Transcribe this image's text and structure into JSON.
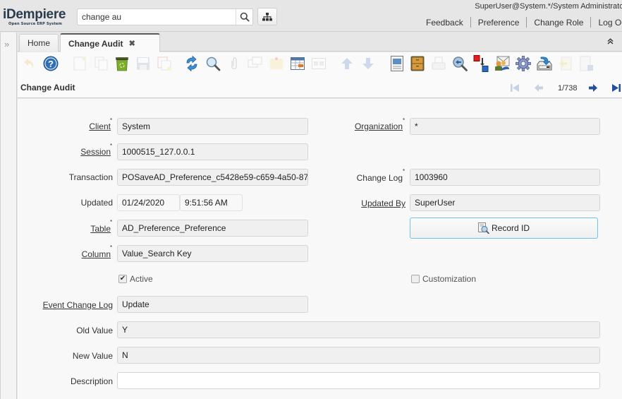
{
  "app": {
    "logo_text": "iDempiere",
    "logo_tagline": "Open Source ERP System"
  },
  "header": {
    "search": {
      "value": "change au",
      "placeholder": ""
    },
    "search_icon": "search-icon",
    "menu_tree_icon": "sitemap-icon",
    "user_info": "SuperUser@System.*/System Administrator",
    "links": [
      "Feedback",
      "Preference",
      "Change Role",
      "Log Out"
    ]
  },
  "tabs": [
    {
      "label": "Home",
      "active": false
    },
    {
      "label": "Change Audit",
      "active": true,
      "closable": true
    }
  ],
  "tab_close_glyph": "✖",
  "west_expand_glyph": "»",
  "collapse_glyph": "⌃",
  "toolbar": {
    "buttons": [
      {
        "name": "undo",
        "icon": "undo-icon",
        "enabled": false
      },
      {
        "name": "help",
        "icon": "help-icon",
        "enabled": true
      },
      {
        "name": "new",
        "icon": "new-record-icon",
        "enabled": false
      },
      {
        "name": "copy",
        "icon": "copy-record-icon",
        "enabled": false
      },
      {
        "name": "delete",
        "icon": "delete-icon",
        "enabled": true
      },
      {
        "name": "save",
        "icon": "save-icon",
        "enabled": false
      },
      {
        "name": "save-create",
        "icon": "save-create-icon",
        "enabled": false
      },
      {
        "name": "refresh",
        "icon": "refresh-icon",
        "enabled": true
      },
      {
        "name": "find",
        "icon": "find-icon",
        "enabled": true
      },
      {
        "name": "attachment",
        "icon": "attachment-icon",
        "enabled": false
      },
      {
        "name": "chat",
        "icon": "chat-icon",
        "enabled": false
      },
      {
        "name": "postit",
        "icon": "postit-icon",
        "enabled": false
      },
      {
        "name": "grid-toggle",
        "icon": "grid-toggle-icon",
        "enabled": true
      },
      {
        "name": "multi",
        "icon": "multi-view-icon",
        "enabled": false
      },
      {
        "name": "parent",
        "icon": "arrow-up-icon",
        "enabled": false
      },
      {
        "name": "detail",
        "icon": "arrow-down-icon",
        "enabled": false
      },
      {
        "name": "report",
        "icon": "report-icon",
        "enabled": true
      },
      {
        "name": "archive",
        "icon": "archive-icon",
        "enabled": true
      },
      {
        "name": "print",
        "icon": "print-icon",
        "enabled": false
      },
      {
        "name": "zoom-across",
        "icon": "zoom-across-icon",
        "enabled": true
      },
      {
        "name": "active-workflows",
        "icon": "workflow-icon",
        "enabled": true
      },
      {
        "name": "requests",
        "icon": "requests-icon",
        "enabled": true
      },
      {
        "name": "process",
        "icon": "gear-icon",
        "enabled": true
      },
      {
        "name": "export",
        "icon": "export-icon",
        "enabled": true
      },
      {
        "name": "file-import",
        "icon": "import-icon",
        "enabled": false
      },
      {
        "name": "customize",
        "icon": "customize-icon",
        "enabled": false
      }
    ]
  },
  "window": {
    "title": "Change Audit",
    "record_position": "1/738"
  },
  "form": {
    "client": {
      "label": "Client",
      "value": "System",
      "required": true
    },
    "organization": {
      "label": "Organization",
      "value": "*",
      "required": true
    },
    "session": {
      "label": "Session",
      "value": "1000515_127.0.0.1",
      "required": true
    },
    "transaction": {
      "label": "Transaction",
      "value": "POSaveAD_Preference_c5428e59-c659-4a50-87"
    },
    "change_log": {
      "label": "Change Log",
      "value": "1003960",
      "required": true
    },
    "updated": {
      "label": "Updated",
      "date": "01/24/2020",
      "time": "9:51:56 AM"
    },
    "updated_by": {
      "label": "Updated By",
      "value": "SuperUser"
    },
    "table": {
      "label": "Table",
      "value": "AD_Preference_Preference",
      "required": true
    },
    "record_id_button": "Record ID",
    "column": {
      "label": "Column",
      "value": "Value_Search Key",
      "required": true
    },
    "active": {
      "label": "Active",
      "checked": true
    },
    "customization": {
      "label": "Customization",
      "checked": false
    },
    "event_change_log": {
      "label": "Event Change Log",
      "value": "Update"
    },
    "old_value": {
      "label": "Old Value",
      "value": "Y"
    },
    "new_value": {
      "label": "New Value",
      "value": "N"
    },
    "description": {
      "label": "Description",
      "value": ""
    }
  },
  "colors": {
    "accent_blue": "#1f5fa8",
    "button_focus_border": "#6ec3ea",
    "readonly_field_bg": "#f0f0f0"
  }
}
